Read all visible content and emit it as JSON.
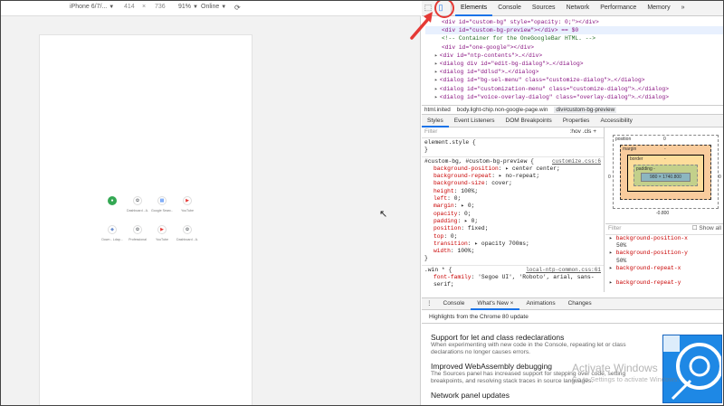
{
  "device_toolbar": {
    "device": "iPhone 6/7/...",
    "width": "414",
    "times": "×",
    "height": "736",
    "zoom": "91%",
    "throttle": "Online"
  },
  "ntp_tiles": [
    {
      "label": "",
      "color": "#34a853"
    },
    {
      "label": "Dashboard - A...",
      "color": "#5f6368"
    },
    {
      "label": "Google Searc...",
      "color": "#4285f4"
    },
    {
      "label": "YouTube",
      "color": "#e53935"
    },
    {
      "label": "Down - Ldap...",
      "color": "#6b8ecf"
    },
    {
      "label": "Professional",
      "color": "#5f6368"
    },
    {
      "label": "YouTube",
      "color": "#e53935"
    },
    {
      "label": "Dashboard - A...",
      "color": "#5f6368"
    }
  ],
  "devtools": {
    "tabs": [
      "Elements",
      "Console",
      "Sources",
      "Network",
      "Performance",
      "Memory",
      "»"
    ],
    "active_tab": "Elements",
    "elements_lines": [
      {
        "tri": "",
        "text": "<div id=\"custom-bg\" style=\"opacity: 0;\"></div>",
        "sel": false,
        "indent": 16
      },
      {
        "tri": "",
        "text": "<div id=\"custom-bg-preview\"></div> == $0",
        "sel": true,
        "indent": 16
      },
      {
        "tri": "",
        "text": "<!-- Container for the OneGoogleBar HTML. -->",
        "sel": false,
        "indent": 16
      },
      {
        "tri": "",
        "text": "<div id=\"one-google\"></div>",
        "sel": false,
        "indent": 16
      },
      {
        "tri": "▸",
        "text": "<div id=\"ntp-contents\">…</div>",
        "sel": false,
        "indent": 10
      },
      {
        "tri": "▸",
        "text": "<dialog div id=\"edit-bg-dialog\">…</dialog>",
        "sel": false,
        "indent": 10
      },
      {
        "tri": "▸",
        "text": "<dialog id=\"ddlsd\">…</dialog>",
        "sel": false,
        "indent": 10
      },
      {
        "tri": "▸",
        "text": "<dialog id=\"bg-sel-menu\" class=\"customize-dialog\">…</dialog>",
        "sel": false,
        "indent": 10
      },
      {
        "tri": "▸",
        "text": "<dialog id=\"customization-menu\" class=\"customize-dialog\">…</dialog>",
        "sel": false,
        "indent": 10
      },
      {
        "tri": "▸",
        "text": "<dialog id=\"voice-overlay-dialog\" class=\"overlay-dialog\">…</dialog>",
        "sel": false,
        "indent": 10
      }
    ],
    "breadcrumb": [
      "html.inited",
      "body.light-chip.non-google-page.win",
      "div#custom-bg-preview"
    ],
    "subtabs": [
      "Styles",
      "Event Listeners",
      "DOM Breakpoints",
      "Properties",
      "Accessibility"
    ],
    "styles": {
      "filter_placeholder": "Filter",
      "hov_cls": ":hov  .cls  +",
      "element_style": "element.style {",
      "close_brace": "}",
      "rule1_selector": "#custom-bg, #custom-bg-preview {",
      "rule1_source": "customize.css:6",
      "rule1_props": [
        {
          "name": "background-position",
          "value": "▸ center center;"
        },
        {
          "name": "background-repeat",
          "value": "▸ no-repeat;"
        },
        {
          "name": "background-size",
          "value": "cover;"
        },
        {
          "name": "height",
          "value": "100%;"
        },
        {
          "name": "left",
          "value": "0;"
        },
        {
          "name": "margin",
          "value": "▸ 0;"
        },
        {
          "name": "opacity",
          "value": "0;"
        },
        {
          "name": "padding",
          "value": "▸ 0;"
        },
        {
          "name": "position",
          "value": "fixed;"
        },
        {
          "name": "top",
          "value": "0;"
        },
        {
          "name": "transition",
          "value": "▸ opacity 700ms;"
        },
        {
          "name": "width",
          "value": "100%;"
        }
      ],
      "rule2_selector": ".win * {",
      "rule2_source": "local-ntp-common.css:61",
      "rule2_props": [
        {
          "name": "font-family",
          "value": "'Segoe UI', 'Roboto', arial, sans-serif;"
        }
      ]
    },
    "box_model": {
      "position_label": "position",
      "position_value": "0",
      "margin_label": "margin",
      "margin_value": "-",
      "border_label": "border",
      "border_value": "-",
      "padding_label": "padding -",
      "content": "980 × 1740.800",
      "left_value": "0",
      "right_value": "0",
      "bottom_value": "-0.800"
    },
    "computed": {
      "filter_placeholder": "Filter",
      "show_all": "Show all",
      "items": [
        {
          "name": "background-position-x",
          "value": "50%"
        },
        {
          "name": "background-position-y",
          "value": "50%"
        },
        {
          "name": "background-repeat-x",
          "value": ""
        },
        {
          "name": "background-repeat-y",
          "value": ""
        }
      ]
    },
    "drawer_tabs": [
      "Console",
      "What's New",
      "Animations",
      "Changes"
    ],
    "drawer_active": "What's New",
    "drawer_close": "×",
    "drawer_heading": "Highlights from the Chrome 80 update",
    "news": [
      {
        "title": "Support for let and class redeclarations",
        "desc": "When experimenting with new code in the Console, repeating let or class declarations no longer causes errors."
      },
      {
        "title": "Improved WebAssembly debugging",
        "desc": "The Sources panel has increased support for stepping over code, setting breakpoints, and resolving stack traces in source languages."
      },
      {
        "title": "Network panel updates",
        "desc": ""
      }
    ],
    "watermark_title": "Activate Windows",
    "watermark_sub": "Go to Settings to activate Windows."
  }
}
